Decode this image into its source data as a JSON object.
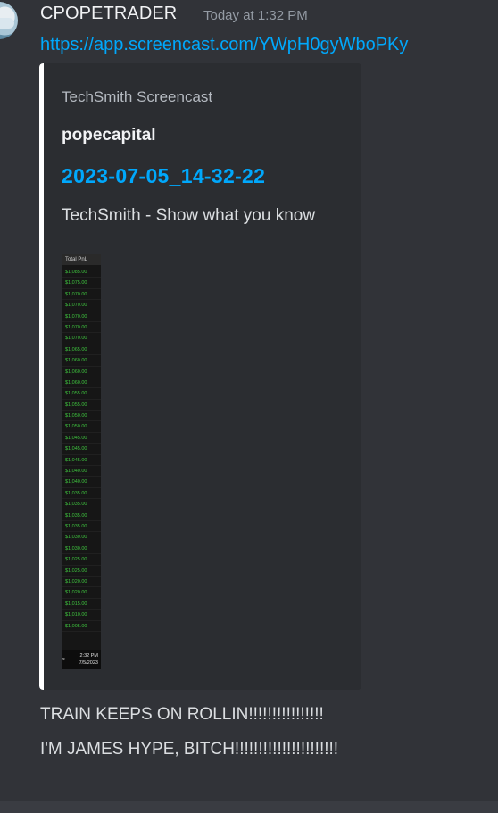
{
  "message": {
    "username": "CPOPETRADER",
    "timestamp": "Today at 1:32 PM",
    "link": "https://app.screencast.com/YWpH0gyWboPKy",
    "lines": [
      "TRAIN KEEPS ON ROLLIN!!!!!!!!!!!!!!!!",
      "I'M JAMES HYPE, BITCH!!!!!!!!!!!!!!!!!!!!!!"
    ]
  },
  "embed": {
    "provider": "TechSmith Screencast",
    "author": "popecapital",
    "title": "2023-07-05_14-32-22",
    "description": "TechSmith - Show what you know",
    "accent_color": "#ffffff",
    "thumbnail": {
      "header": "Total PnL",
      "values": [
        "$1,085.00",
        "$1,075.00",
        "$1,070.00",
        "$1,070.00",
        "$1,070.00",
        "$1,070.00",
        "$1,070.00",
        "$1,065.00",
        "$1,060.00",
        "$1,060.00",
        "$1,060.00",
        "$1,055.00",
        "$1,055.00",
        "$1,050.00",
        "$1,050.00",
        "$1,045.00",
        "$1,045.00",
        "$1,045.00",
        "$1,040.00",
        "$1,040.00",
        "$1,035.00",
        "$1,035.00",
        "$1,035.00",
        "$1,035.00",
        "$1,030.00",
        "$1,030.00",
        "$1,025.00",
        "$1,025.00",
        "$1,020.00",
        "$1,020.00",
        "$1,015.00",
        "$1,010.00",
        "$1,005.00"
      ],
      "value_color": "#3ec23e",
      "taskbar_letter": "s",
      "taskbar_time": "2:32 PM",
      "taskbar_date": "7/5/2023"
    }
  },
  "colors": {
    "background": "#313338",
    "link": "#00a8fc",
    "username": "#f2f3f5",
    "timestamp": "#949ba4",
    "embed_background": "#2b2d31"
  }
}
